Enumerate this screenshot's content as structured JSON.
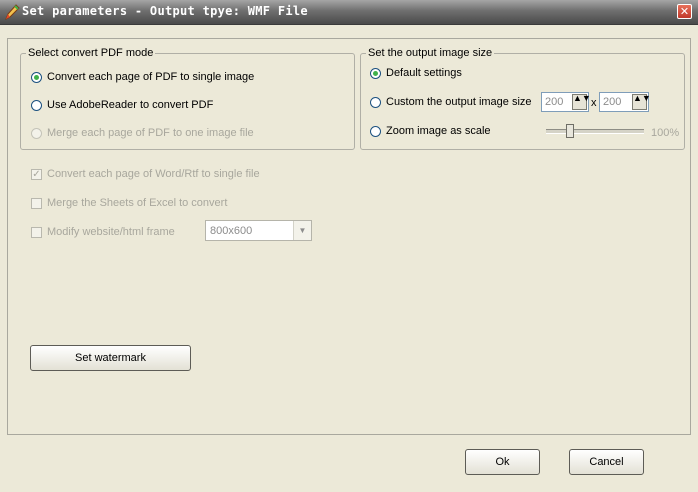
{
  "window": {
    "title": "Set parameters - Output tpye: WMF File",
    "close_glyph": "✕"
  },
  "pdf_mode": {
    "group_title": "Select convert PDF mode",
    "options": [
      {
        "label": "Convert each page of PDF to single image",
        "checked": true,
        "enabled": true
      },
      {
        "label": "Use AdobeReader to convert PDF",
        "checked": false,
        "enabled": true
      },
      {
        "label": "Merge each page of PDF to one image file",
        "checked": false,
        "enabled": false
      }
    ]
  },
  "image_size": {
    "group_title": "Set the output image size",
    "default_label": "Default settings",
    "custom_label": "Custom the output image size",
    "width_value": "200",
    "separator": "x",
    "height_value": "200",
    "zoom_label": "Zoom image as scale",
    "zoom_value": "100%",
    "zoom_slider_fraction": 0.22
  },
  "options": {
    "word_label": "Convert each page of Word/Rtf to single file",
    "word_checked": true,
    "excel_label": "Merge the Sheets of Excel to convert",
    "excel_checked": false,
    "website_label": "Modify website/html frame",
    "website_checked": false,
    "frame_size": "800x600"
  },
  "buttons": {
    "watermark": "Set watermark",
    "ok": "Ok",
    "cancel": "Cancel"
  },
  "icons": {
    "app": "pencil-icon",
    "check": "✓",
    "spin": "▲▼",
    "dropdown": "▼"
  }
}
